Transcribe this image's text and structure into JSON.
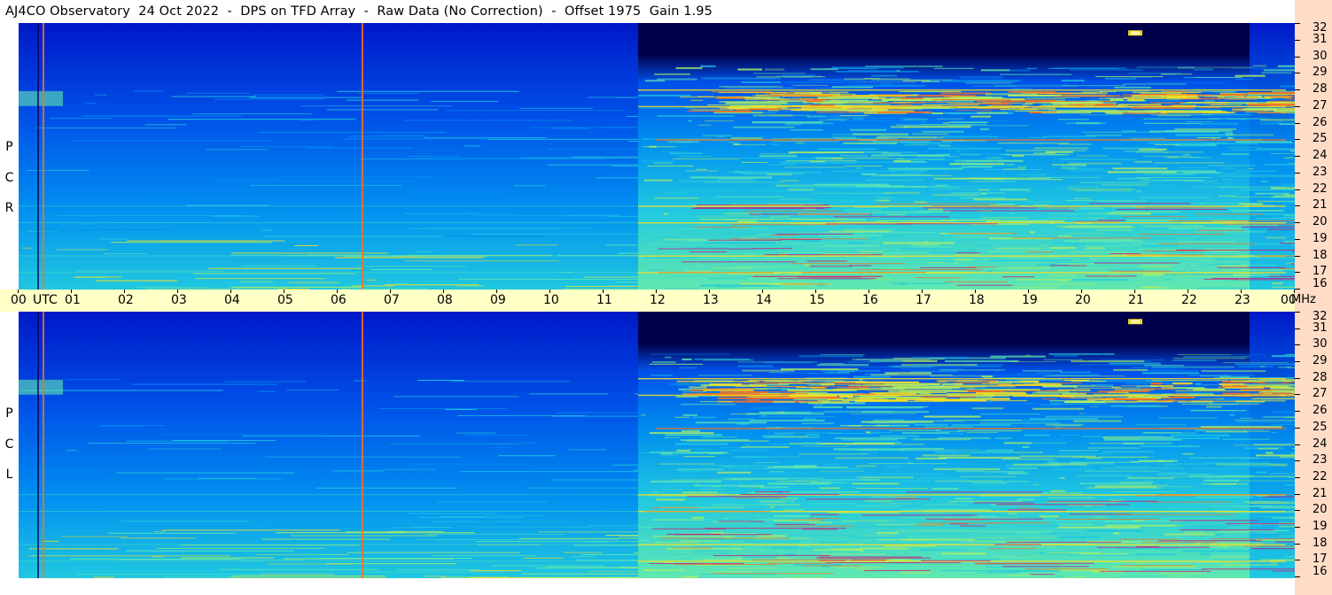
{
  "title": "AJ4CO Observatory  24 Oct 2022  -  DPS on TFD Array  -  Raw Data (No Correction)  -  Offset 1975  Gain 1.95",
  "panels": [
    {
      "id": "rcp",
      "letters": [
        "R",
        "C",
        "P"
      ]
    },
    {
      "id": "lcp",
      "letters": [
        "L",
        "C",
        "P"
      ]
    }
  ],
  "time_axis": {
    "labels": [
      "00",
      "01",
      "02",
      "03",
      "04",
      "05",
      "06",
      "07",
      "08",
      "09",
      "10",
      "11",
      "12",
      "13",
      "14",
      "15",
      "16",
      "17",
      "18",
      "19",
      "20",
      "21",
      "22",
      "23",
      "00"
    ],
    "unit": "UTC"
  },
  "freq_axis": {
    "labels": [
      "32",
      "31",
      "30",
      "29",
      "28",
      "27",
      "26",
      "25",
      "24",
      "23",
      "22",
      "21",
      "20",
      "19",
      "18",
      "17",
      "16"
    ],
    "unit": "MHz"
  },
  "colors": {
    "time_axis_bg": "#ffffc6",
    "freq_axis_bg": "#ffdcc6",
    "colormap": [
      "#00004a",
      "#0018c8",
      "#0050e8",
      "#0090f0",
      "#20c8e0",
      "#60e8b0",
      "#b0f060",
      "#f8e020",
      "#f87020",
      "#e00070"
    ]
  },
  "chart_data": {
    "type": "heatmap",
    "title": "AJ4CO Observatory  24 Oct 2022  -  DPS on TFD Array  -  Raw Data (No Correction)  -  Offset 1975  Gain 1.95",
    "x_label": "UTC",
    "x_range_hours": [
      0,
      24
    ],
    "y_label": "MHz",
    "y_range_mhz": [
      16,
      32
    ],
    "panels": [
      "RCP",
      "LCP"
    ],
    "features": {
      "night_quiet_until_hour": 11.65,
      "daytime_high_band_dark_from_hour": 11.65,
      "daytime_high_band_dark_to_hour": 23.15,
      "vertical_artifact_hours": [
        0.45,
        6.45
      ],
      "persistent_carriers_mhz": [
        17.0,
        18.0,
        20.0,
        21.0,
        25.0,
        27.0,
        28.0
      ],
      "solar_burst_hour": 21.0,
      "solar_burst_mhz": 31.4
    }
  }
}
